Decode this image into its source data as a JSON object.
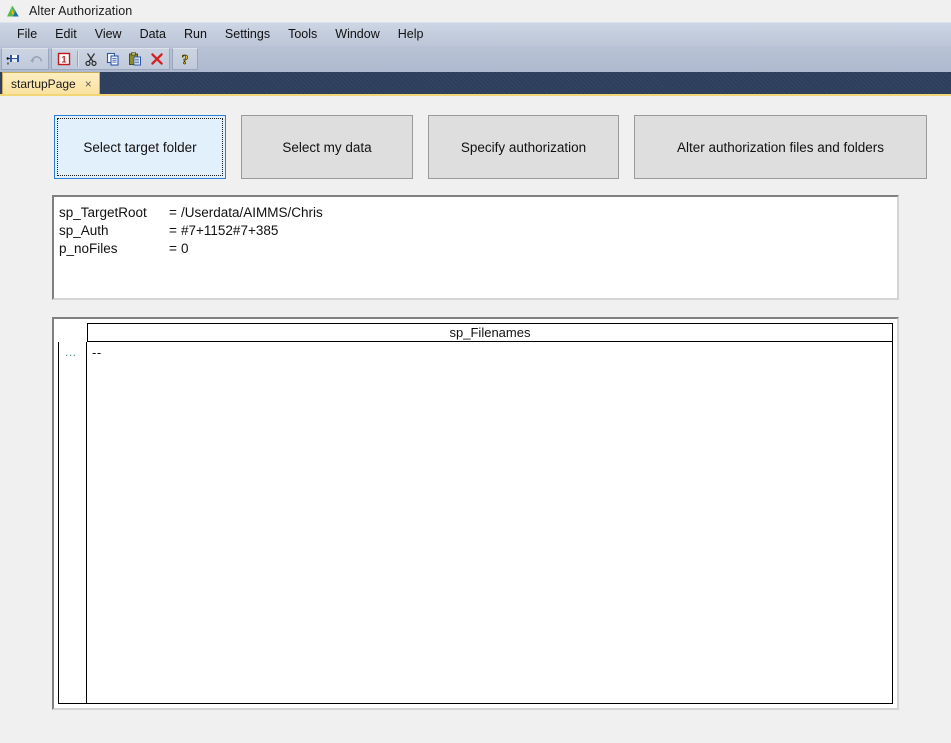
{
  "titlebar": {
    "app_title": "Alter Authorization",
    "logo_icon": "aimms-logo-icon"
  },
  "menubar": {
    "items": [
      {
        "label": "File"
      },
      {
        "label": "Edit"
      },
      {
        "label": "View"
      },
      {
        "label": "Data"
      },
      {
        "label": "Run"
      },
      {
        "label": "Settings"
      },
      {
        "label": "Tools"
      },
      {
        "label": "Window"
      },
      {
        "label": "Help"
      }
    ]
  },
  "toolbar": {
    "groups": [
      {
        "buttons": [
          {
            "icon": "save-all-icon",
            "name": "save-button"
          },
          {
            "icon": "undo-arrow-icon",
            "name": "undo-button"
          }
        ]
      },
      {
        "buttons": [
          {
            "icon": "page-one-icon",
            "name": "page-properties-button"
          },
          {
            "icon": "scissors-cut-icon",
            "name": "cut-button"
          },
          {
            "icon": "copy-pages-icon",
            "name": "copy-button"
          },
          {
            "icon": "clipboard-paste-icon",
            "name": "paste-button"
          },
          {
            "icon": "red-x-delete-icon",
            "name": "delete-button"
          }
        ]
      },
      {
        "buttons": [
          {
            "icon": "question-mark-help-icon",
            "name": "help-button"
          }
        ]
      }
    ]
  },
  "tabstrip": {
    "active_tab": "startupPage",
    "close_glyph": "×"
  },
  "page": {
    "buttons": [
      {
        "label": "Select target folder",
        "focused": true
      },
      {
        "label": "Select my data",
        "focused": false
      },
      {
        "label": "Specify authorization",
        "focused": false
      },
      {
        "label": "Alter authorization files and folders",
        "focused": false
      }
    ],
    "scalars": [
      {
        "identifier": "sp_TargetRoot",
        "equals": "=",
        "value": "/Userdata/AIMMS/Chris"
      },
      {
        "identifier": "sp_Auth",
        "equals": "=",
        "value": "#7+1152#7+385"
      },
      {
        "identifier": "p_noFiles",
        "equals": "=",
        "value": "0"
      }
    ],
    "table": {
      "column_header": "sp_Filenames",
      "row_header": "...",
      "cell_value": "--"
    }
  },
  "colors": {
    "accent_blue": "#2a7fd4",
    "focus_fill": "#e2f0fb",
    "tab_navy": "#2d3e5c",
    "tab_active": "#fae2a0",
    "tab_underline": "#f2d675",
    "button_face": "#dedede",
    "page_bg": "#f0f0f0"
  }
}
